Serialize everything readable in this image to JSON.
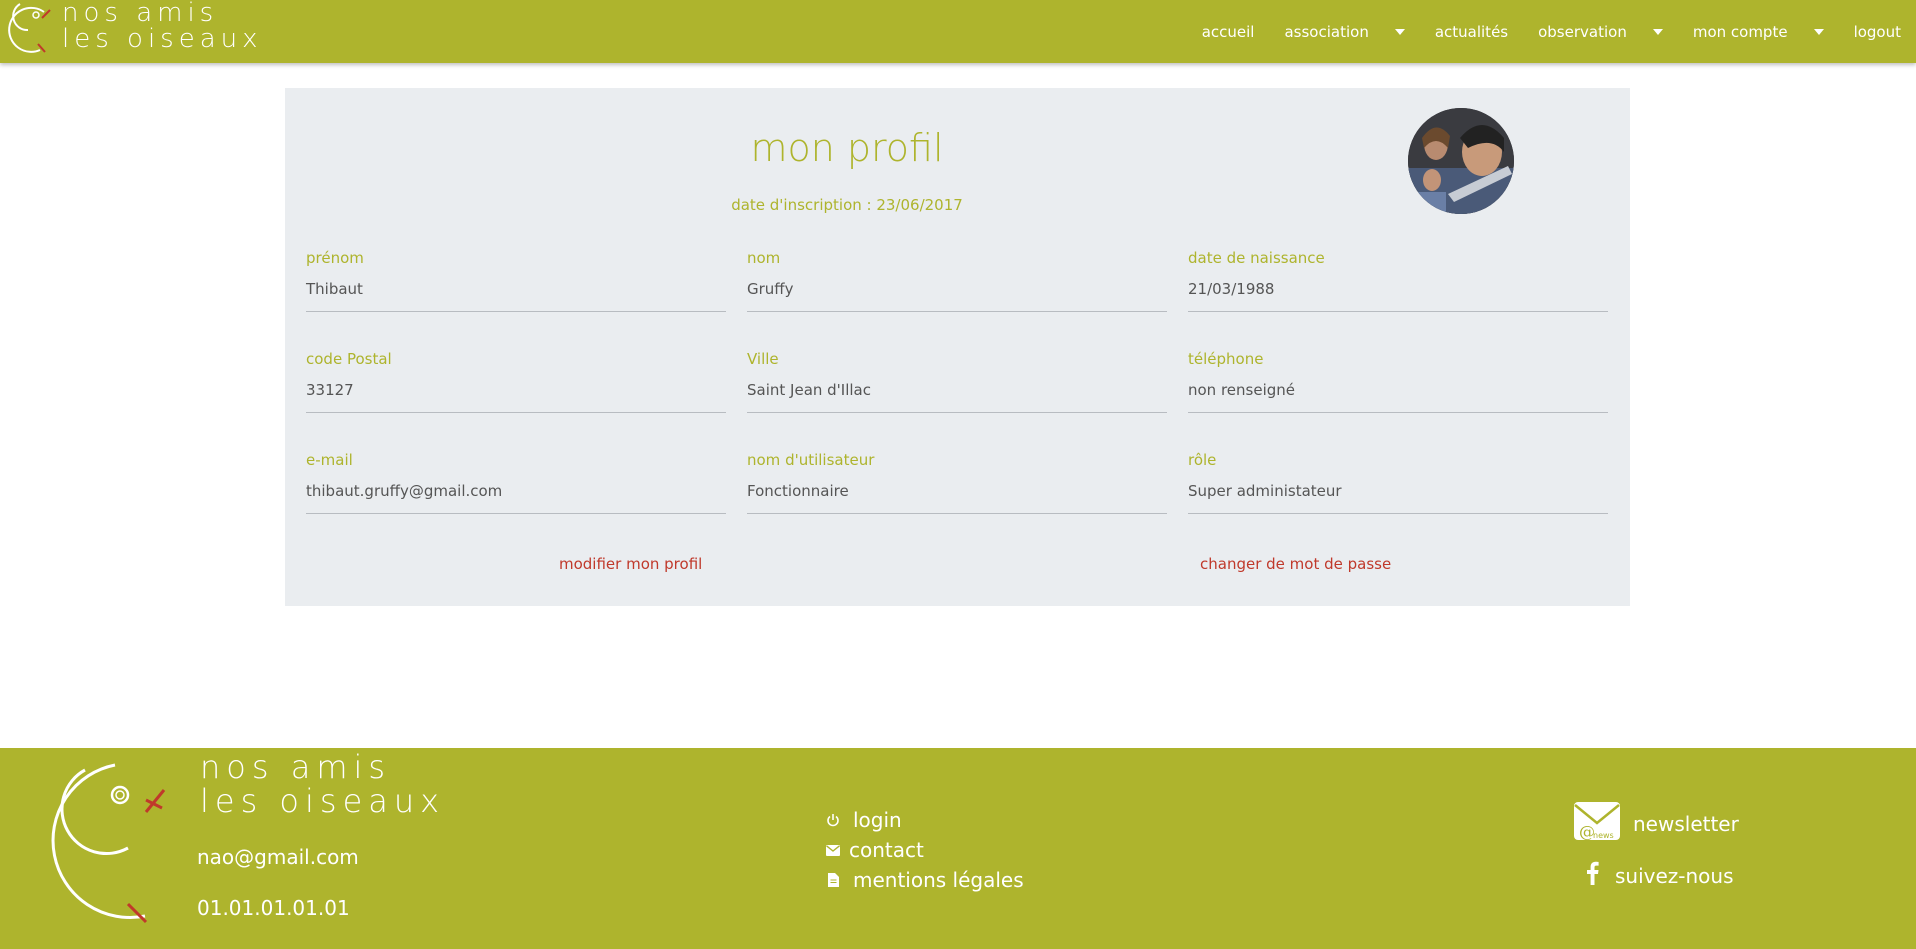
{
  "brand": {
    "line1": "nos amis",
    "line2": "les oiseaux"
  },
  "nav": {
    "items": [
      {
        "label": "accueil",
        "dropdown": false
      },
      {
        "label": "association",
        "dropdown": true
      },
      {
        "label": "actualités",
        "dropdown": false
      },
      {
        "label": "observation",
        "dropdown": true
      },
      {
        "label": "mon compte",
        "dropdown": true
      },
      {
        "label": "logout",
        "dropdown": false
      }
    ]
  },
  "profile": {
    "title": "mon profil",
    "date": "date d'inscription : 23/06/2017",
    "fields": {
      "prenom": {
        "label": "prénom",
        "value": "Thibaut"
      },
      "nom": {
        "label": "nom",
        "value": "Gruffy"
      },
      "naissance": {
        "label": "date de naissance",
        "value": "21/03/1988"
      },
      "cp": {
        "label": "code Postal",
        "value": "33127"
      },
      "ville": {
        "label": "Ville",
        "value": "Saint Jean d'Illac"
      },
      "tel": {
        "label": "téléphone",
        "value": "non renseigné"
      },
      "email": {
        "label": "e-mail",
        "value": "thibaut.gruffy@gmail.com"
      },
      "username": {
        "label": "nom d'utilisateur",
        "value": "Fonctionnaire"
      },
      "role": {
        "label": "rôle",
        "value": "Super administateur"
      }
    },
    "actions": {
      "edit": "modifier mon profil",
      "password": "changer de mot de passe"
    }
  },
  "footer": {
    "brand_line1": "nos amis",
    "brand_line2": "les oiseaux",
    "email": "nao@gmail.com",
    "phone": "01.01.01.01.01",
    "links": {
      "login": "login",
      "contact": "contact",
      "legal": "mentions légales"
    },
    "newsletter": "newsletter",
    "follow": "suivez-nous"
  },
  "colors": {
    "primary": "#aeb42d",
    "card": "#eaedf0",
    "action": "#c0392b"
  }
}
